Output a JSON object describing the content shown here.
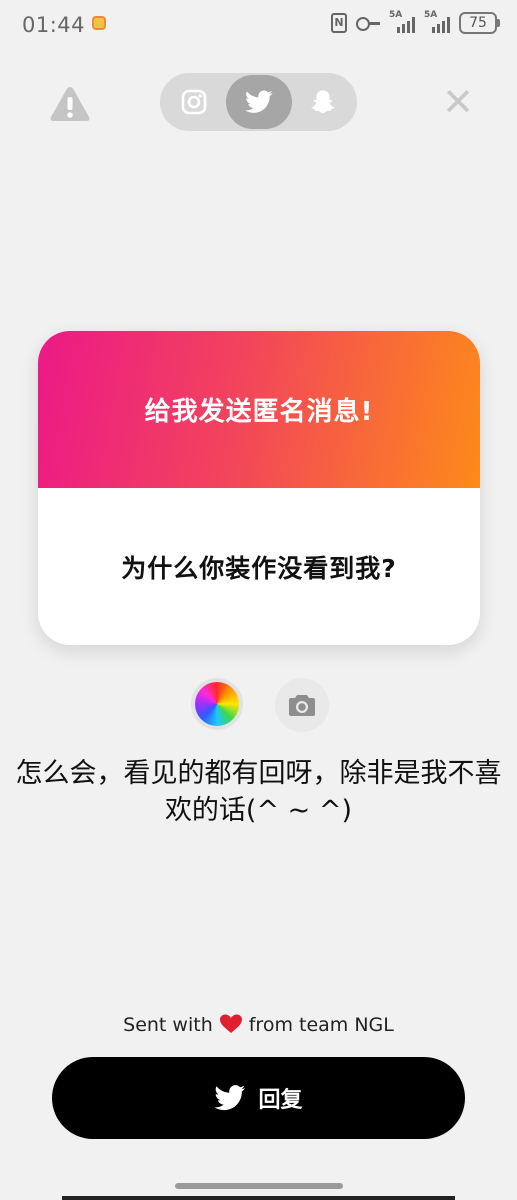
{
  "status_bar": {
    "time": "01:44",
    "signal1_label": "5A",
    "signal2_label": "5A",
    "battery": "75"
  },
  "top_bar": {
    "platforms": [
      "instagram",
      "twitter",
      "snapchat"
    ],
    "active_platform": "twitter"
  },
  "card": {
    "title": "给我发送匿名消息!",
    "question": "为什么你装作没看到我?"
  },
  "reply_text": "怎么会，看见的都有回呀，除非是我不喜欢的话(^ ~ ^)",
  "footer": {
    "sent_with_prefix": "Sent with",
    "sent_with_suffix": "from team NGL"
  },
  "reply_button": {
    "label": "回复"
  },
  "colors": {
    "gradient_start": "#ec1987",
    "gradient_end": "#fd8a1a",
    "button_bg": "#000000",
    "background": "#f1f1f1"
  }
}
